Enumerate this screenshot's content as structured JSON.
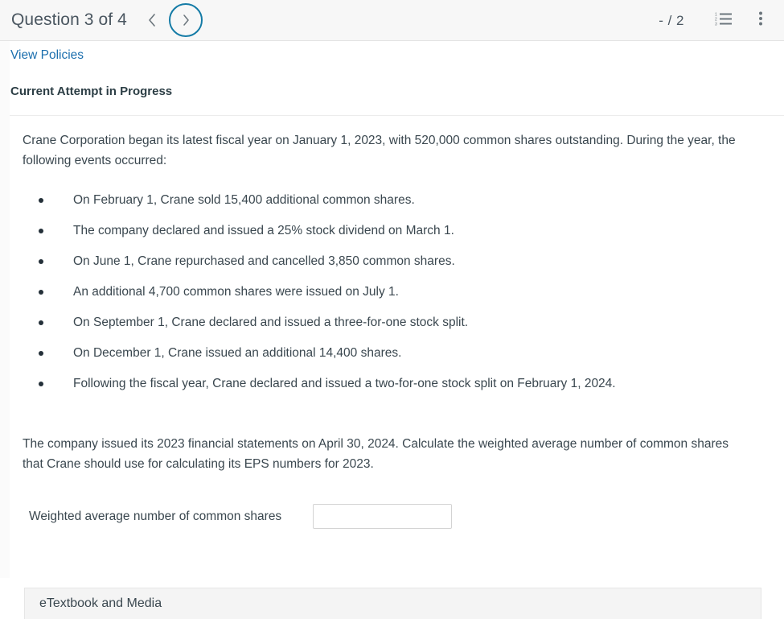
{
  "header": {
    "question_title": "Question 3 of 4",
    "prev_icon": "chevron-left-icon",
    "next_icon": "chevron-right-icon",
    "score": "- / 2",
    "list_icon": "numbered-list-icon",
    "menu_icon": "more-vertical-icon",
    "accent_color": "#147ba6",
    "background_color": "#f7f7f7"
  },
  "toolbar": {
    "view_policies_label": "View Policies",
    "link_color": "#1b6fae"
  },
  "attempt": {
    "status_label": "Current Attempt in Progress"
  },
  "question": {
    "intro": "Crane Corporation began its latest fiscal year on January 1, 2023, with 520,000 common shares outstanding. During the year, the following events occurred:",
    "events": [
      "On February 1, Crane sold 15,400 additional common shares.",
      "The company declared and issued a 25% stock dividend on March 1.",
      "On June 1, Crane repurchased and cancelled 3,850 common shares.",
      "An additional 4,700 common shares were issued on July 1.",
      "On September 1, Crane declared and issued a three-for-one stock split.",
      "On December 1, Crane issued an additional 14,400 shares.",
      "Following the fiscal year, Crane declared and issued a two-for-one stock split on February 1, 2024."
    ],
    "closing": "The company issued its 2023 financial statements on April 30, 2024. Calculate the weighted average number of common shares that Crane should use for calculating its EPS numbers for 2023."
  },
  "answer": {
    "label": "Weighted average number of common shares",
    "value": "",
    "placeholder": ""
  },
  "footer": {
    "etextbook_label": "eTextbook and Media"
  }
}
